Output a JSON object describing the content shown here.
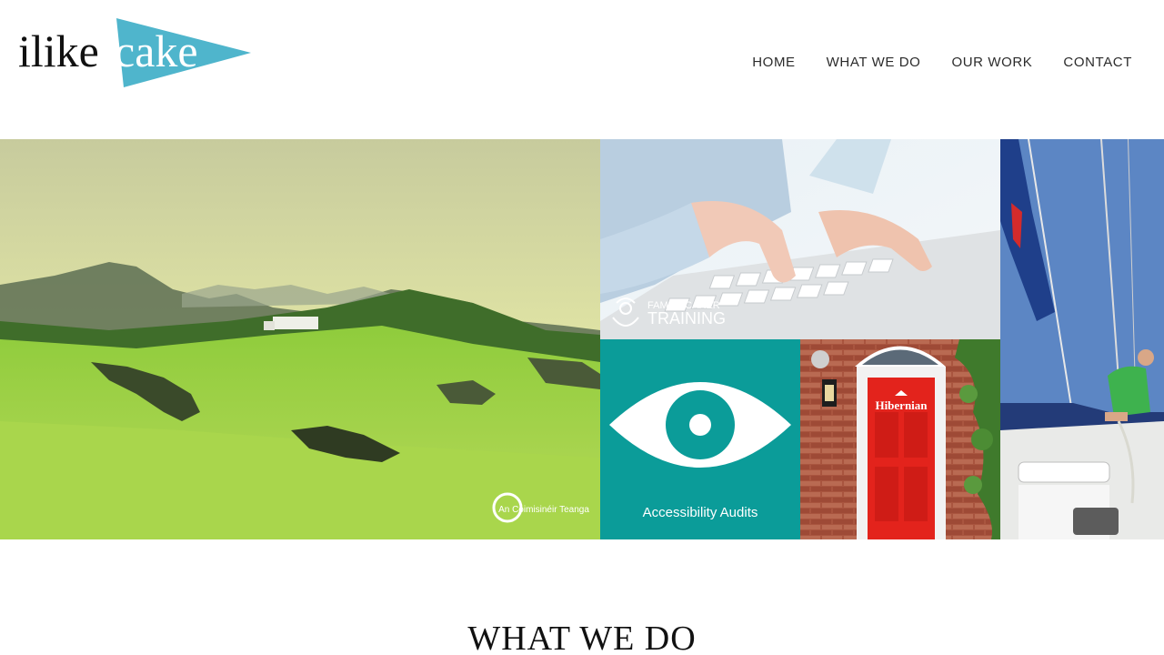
{
  "logo": {
    "text_dark": "ilike",
    "text_light": "cake",
    "accent": "#4fb5cc"
  },
  "nav": {
    "items": [
      {
        "label": "HOME"
      },
      {
        "label": "WHAT WE DO"
      },
      {
        "label": "OUR WORK"
      },
      {
        "label": "CONTACT"
      }
    ]
  },
  "gallery": {
    "tiles": [
      {
        "name": "landscape",
        "caption": "An Coimisinéir Teanga"
      },
      {
        "name": "keyboard",
        "caption_small": "FAMILY CARER",
        "caption_big": "TRAINING"
      },
      {
        "name": "accessibility",
        "caption": "Accessibility Audits",
        "color": "#0b9c99"
      },
      {
        "name": "door",
        "caption": "Hibernian",
        "door_color": "#e8241c"
      },
      {
        "name": "sailing"
      }
    ]
  },
  "section": {
    "title": "WHAT WE DO"
  }
}
